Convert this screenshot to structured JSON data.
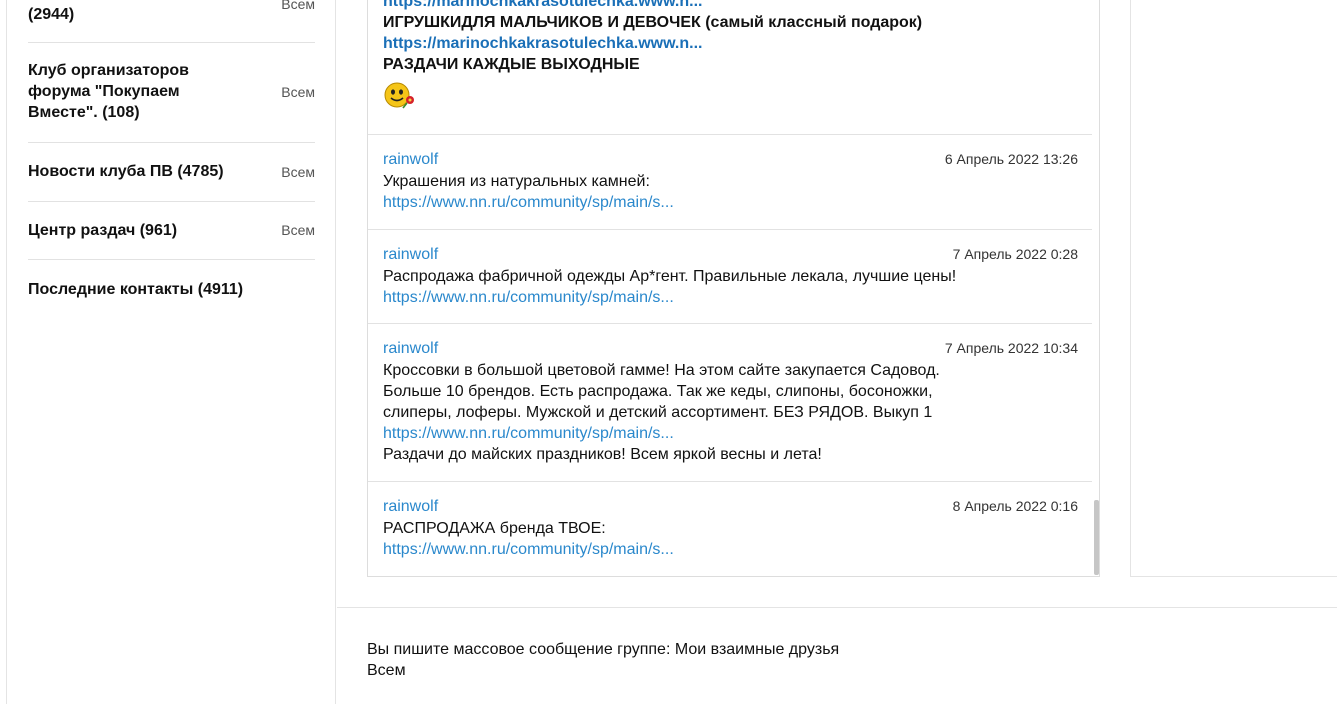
{
  "sidebar": {
    "groups": [
      {
        "name": "(2944)",
        "all_label": "Всем"
      },
      {
        "name": "Клуб организаторов форума \"Покупаем Вместе\". (108)",
        "all_label": "Всем"
      },
      {
        "name": "Новости клуба ПВ (4785)",
        "all_label": "Всем"
      },
      {
        "name": "Центр раздач (961)",
        "all_label": "Всем"
      },
      {
        "name": "Последние контакты (4911)",
        "all_label": ""
      }
    ]
  },
  "top_message": {
    "lines": [
      "https://marinochkakrasotulechka.www.n...",
      "ИГРУШКИДЛЯ МАЛЬЧИКОВ И ДЕВОЧЕК (самый классный подарок)",
      "https://marinochkakrasotulechka.www.n...",
      "РАЗДАЧИ КАЖДЫЕ ВЫХОДНЫЕ"
    ],
    "emoticon": "smiley-with-flower-icon"
  },
  "messages": [
    {
      "author": "rainwolf",
      "date": "6 Апрель 2022 13:26",
      "text": "Украшения из натуральных камней:",
      "link": "https://www.nn.ru/community/sp/main/s..."
    },
    {
      "author": "rainwolf",
      "date": "7 Апрель 2022 0:28",
      "text": "Распродажа фабричной одежды Ар*гент. Правильные лекала, лучшие цены!",
      "link": "https://www.nn.ru/community/sp/main/s..."
    },
    {
      "author": "rainwolf",
      "date": "7 Апрель 2022 10:34",
      "text_lines": [
        "Кроссовки в большой цветовой гамме! На этом сайте закупается Садовод.",
        "Больше 10 брендов. Есть распродажа. Так же кеды, слипоны, босоножки,",
        "слиперы, лоферы. Мужской и детский ассортимент. БЕЗ РЯДОВ. Выкуп 1"
      ],
      "link": "https://www.nn.ru/community/sp/main/s...",
      "after_text": "Раздачи до майских праздников! Всем яркой весны и лета!"
    },
    {
      "author": "rainwolf",
      "date": "8 Апрель 2022 0:16",
      "text": "РАСПРОДАЖА бренда ТВОЕ:",
      "link": "https://www.nn.ru/community/sp/main/s..."
    }
  ],
  "compose": {
    "notice": "Вы пишите массовое сообщение группе: Мои взаимные друзья",
    "recipient": "Всем"
  }
}
